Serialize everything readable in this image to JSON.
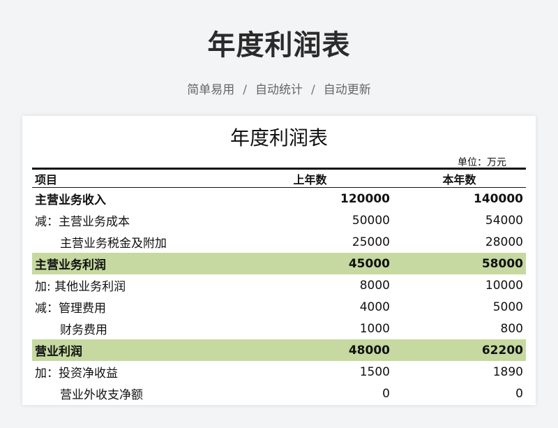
{
  "page": {
    "title": "年度利润表",
    "subtitle": {
      "parts": [
        "简单易用",
        "自动统计",
        "自动更新"
      ],
      "separator": "/"
    }
  },
  "sheet": {
    "title": "年度利润表",
    "unit": "单位：万元",
    "headers": [
      "项目",
      "上年数",
      "本年数"
    ],
    "rows": [
      {
        "label": "主营业务收入",
        "prev": "120000",
        "curr": "140000",
        "bold": true,
        "highlight": false,
        "indent": false
      },
      {
        "label": "减：主营业务成本",
        "prev": "50000",
        "curr": "54000",
        "bold": false,
        "highlight": false,
        "indent": false
      },
      {
        "label": "主营业务税金及附加",
        "prev": "25000",
        "curr": "28000",
        "bold": false,
        "highlight": false,
        "indent": true
      },
      {
        "label": "主营业务利润",
        "prev": "45000",
        "curr": "58000",
        "bold": true,
        "highlight": true,
        "indent": false
      },
      {
        "label": "加: 其他业务利润",
        "prev": "8000",
        "curr": "10000",
        "bold": false,
        "highlight": false,
        "indent": false
      },
      {
        "label": "减：管理费用",
        "prev": "4000",
        "curr": "5000",
        "bold": false,
        "highlight": false,
        "indent": false
      },
      {
        "label": "财务费用",
        "prev": "1000",
        "curr": "800",
        "bold": false,
        "highlight": false,
        "indent": true
      },
      {
        "label": "营业利润",
        "prev": "48000",
        "curr": "62200",
        "bold": true,
        "highlight": true,
        "indent": false
      },
      {
        "label": "加：投资净收益",
        "prev": "1500",
        "curr": "1890",
        "bold": false,
        "highlight": false,
        "indent": false
      },
      {
        "label": "营业外收支净额",
        "prev": "0",
        "curr": "0",
        "bold": false,
        "highlight": false,
        "indent": true
      }
    ]
  },
  "colors": {
    "background": "#f3f4f6",
    "highlight_row": "#c6d9a0",
    "title_text": "#2b2b2b",
    "subtitle_text": "#666666"
  }
}
